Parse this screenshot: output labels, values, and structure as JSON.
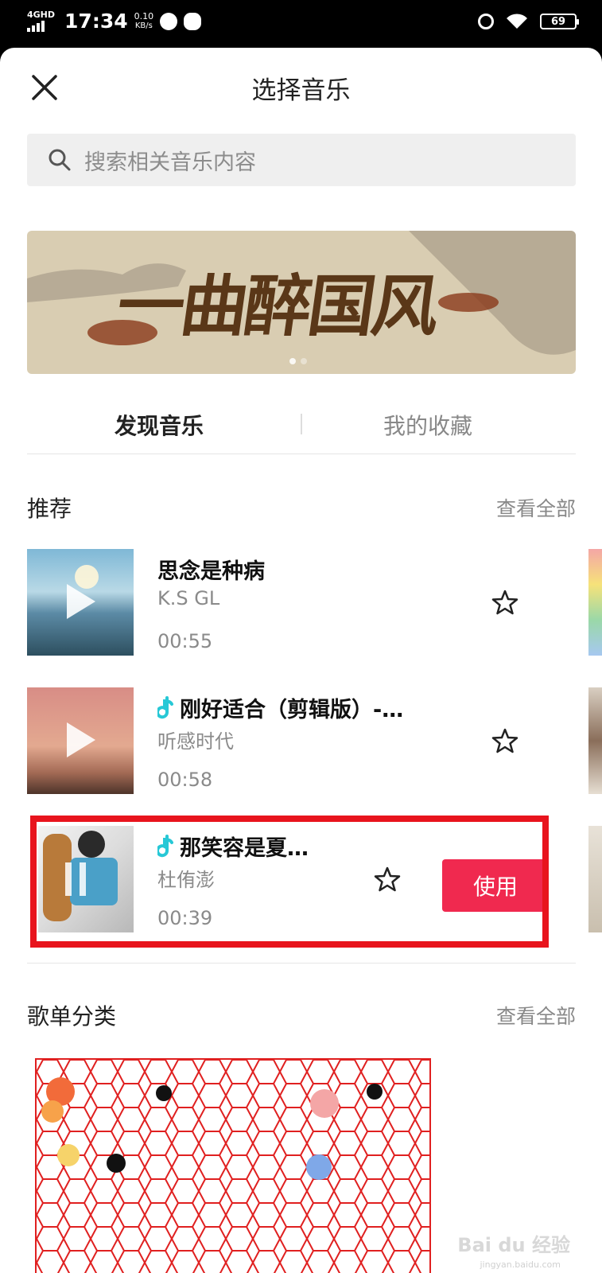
{
  "status_bar": {
    "network": "4GHD",
    "time": "17:34",
    "speed_value": "0.10",
    "speed_unit": "KB/s",
    "battery": "69"
  },
  "header": {
    "title": "选择音乐"
  },
  "search": {
    "placeholder": "搜索相关音乐内容"
  },
  "banner": {
    "text": "一曲醉国风",
    "colors": {
      "bg": "#d9cdb2",
      "ink": "#5a3718"
    }
  },
  "tabs": {
    "discover": "发现音乐",
    "favorites": "我的收藏"
  },
  "recommend": {
    "title": "推荐",
    "view_all": "查看全部",
    "songs": [
      {
        "name": "思念是种病",
        "artist": "K.S GL",
        "duration": "00:55",
        "state": "paused"
      },
      {
        "name": "刚好适合（剪辑版）-…",
        "artist": "听感时代",
        "duration": "00:58",
        "state": "paused"
      },
      {
        "name": "那笑容是夏…",
        "artist": "杜侑澎",
        "duration": "00:39",
        "state": "playing",
        "use_label": "使用"
      }
    ]
  },
  "playlist_section": {
    "title": "歌单分类",
    "view_all": "查看全部"
  },
  "watermark": {
    "brand": "Bai du 经验",
    "url": "jingyan.baidu.com"
  },
  "colors": {
    "accent": "#f0294f",
    "highlight_box": "#e8141d"
  }
}
